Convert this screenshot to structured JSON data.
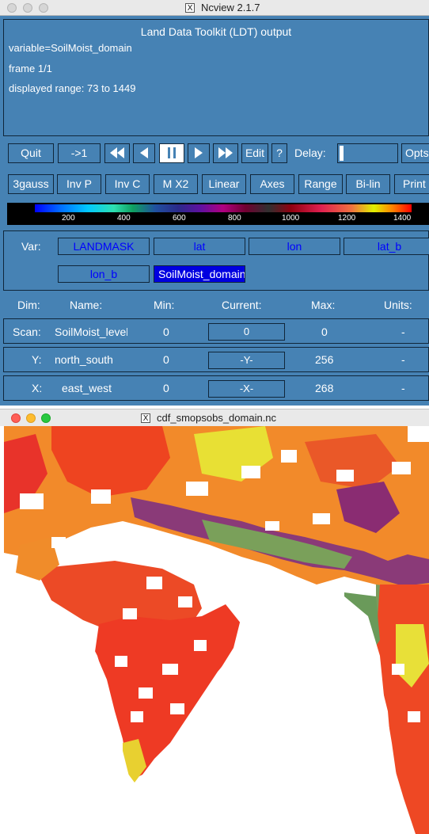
{
  "ncview_window": {
    "title": "Ncview 2.1.7",
    "info": {
      "title": "Land Data Toolkit (LDT) output",
      "variable_line": "variable=SoilMoist_domain",
      "frame_line": "frame 1/1",
      "range_line": "displayed range: 73 to 1449"
    },
    "toolbar": {
      "quit": "Quit",
      "forward_one": "->1",
      "edit": "Edit",
      "help": "?",
      "delay_label": "Delay:",
      "opts": "Opts"
    },
    "options": [
      "3gauss",
      "Inv P",
      "Inv C",
      "M X2",
      "Linear",
      "Axes",
      "Range",
      "Bi-lin",
      "Print"
    ],
    "colorbar": {
      "labels": [
        "200",
        "400",
        "600",
        "800",
        "1000",
        "1200",
        "1400"
      ]
    },
    "variables": {
      "label": "Var:",
      "items": [
        "LANDMASK",
        "lat",
        "lon",
        "lat_b",
        "lon_b",
        "SoilMoist_domain"
      ],
      "selected": "SoilMoist_domain"
    },
    "dimensions": {
      "headers": {
        "dim": "Dim:",
        "name": "Name:",
        "min": "Min:",
        "current": "Current:",
        "max": "Max:",
        "units": "Units:"
      },
      "rows": [
        {
          "dim": "Scan:",
          "name": "SoilMoist_levels",
          "min": "0",
          "current": "0",
          "max": "0",
          "units": "-"
        },
        {
          "dim": "Y:",
          "name": "north_south",
          "min": "0",
          "current": "-Y-",
          "max": "256",
          "units": "-"
        },
        {
          "dim": "X:",
          "name": "east_west",
          "min": "0",
          "current": "-X-",
          "max": "268",
          "units": "-"
        }
      ]
    }
  },
  "map_window": {
    "title": "cdf_smopsobs_domain.nc"
  },
  "colors": {
    "panel_bg": "#4682b4",
    "panel_border": "#10263a",
    "variable_text": "#0000ff",
    "selected_variable_bg": "#0000e0"
  }
}
